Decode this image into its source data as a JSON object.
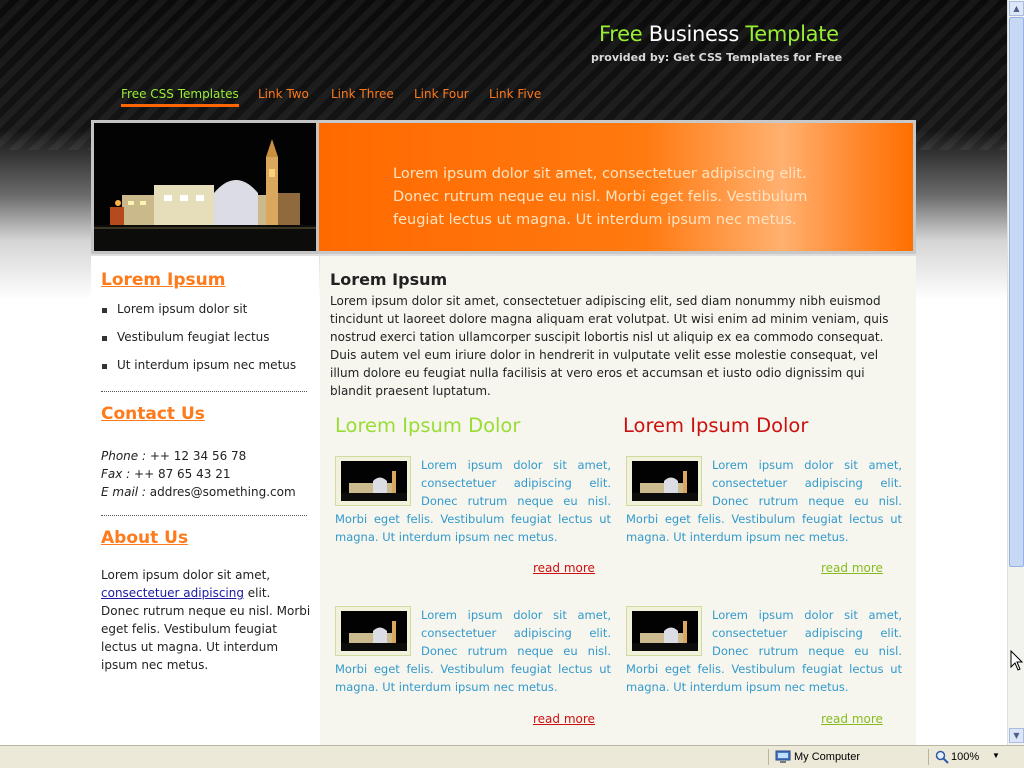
{
  "site": {
    "title_a": "Free",
    "title_b": " Business ",
    "title_c": "Template",
    "subtitle": "provided by: Get CSS Templates for Free"
  },
  "nav": [
    "Free CSS Templates",
    "Link Two",
    "Link Three",
    "Link Four",
    "Link Five"
  ],
  "banner": {
    "text": "Lorem ipsum dolor sit amet, consectetuer adipiscing elit. Donec rutrum neque eu nisl. Morbi eget felis. Vestibulum feugiat lectus ut magna. Ut interdum ipsum nec metus."
  },
  "sidebar": {
    "lorem_heading": "Lorem Ipsum",
    "lorem_items": [
      "Lorem ipsum dolor sit",
      "Vestibulum feugiat lectus",
      "Ut interdum ipsum nec metus"
    ],
    "contact_heading": "Contact Us",
    "phone_label": "Phone :",
    "phone": " ++ 12 34 56 78",
    "fax_label": "Fax :",
    "fax": " ++ 87 65 43 21",
    "email_label": "E mail :",
    "email": " addres@something.com",
    "about_heading": "About Us",
    "about_pre": "Lorem ipsum dolor sit amet, ",
    "about_link": "consectetuer adipiscing",
    "about_post": " elit. Donec rutrum neque eu nisl. Morbi eget felis. Vestibulum feugiat lectus ut magna. Ut interdum ipsum nec metus."
  },
  "main": {
    "heading": "Lorem Ipsum",
    "paragraph": "Lorem ipsum dolor sit amet, consectetuer adipiscing elit, sed diam nonummy nibh euismod tincidunt ut laoreet dolore magna aliquam erat volutpat. Ut wisi enim ad minim veniam, quis nostrud exerci tation ullamcorper suscipit lobortis nisl ut aliquip ex ea commodo consequat. Duis autem vel eum iriure dolor in hendrerit in vulputate velit esse molestie consequat, vel illum dolore eu feugiat nulla facilisis at vero eros et accumsan et iusto odio dignissim qui blandit praesent luptatum.",
    "col1_heading": "Lorem Ipsum Dolor",
    "col2_heading": "Lorem Ipsum Dolor",
    "item_text": "Lorem ipsum dolor sit amet, consectetuer adipiscing elit. Donec rutrum neque eu nisl. Morbi eget felis. Vestibulum feugiat lectus ut magna. Ut interdum ipsum nec metus.",
    "read_more": "read more"
  },
  "statusbar": {
    "zone": "My Computer",
    "zoom": "100%"
  },
  "colors": {
    "green": "#99ee33",
    "orange": "#ff7a1a",
    "red": "#cc1111",
    "item_blue": "#3399cc",
    "col1_heading": "#99dd33"
  },
  "icons": [
    "computer-icon",
    "zoom-icon",
    "scroll-up-icon",
    "scroll-down-icon",
    "mouse-cursor-icon"
  ]
}
